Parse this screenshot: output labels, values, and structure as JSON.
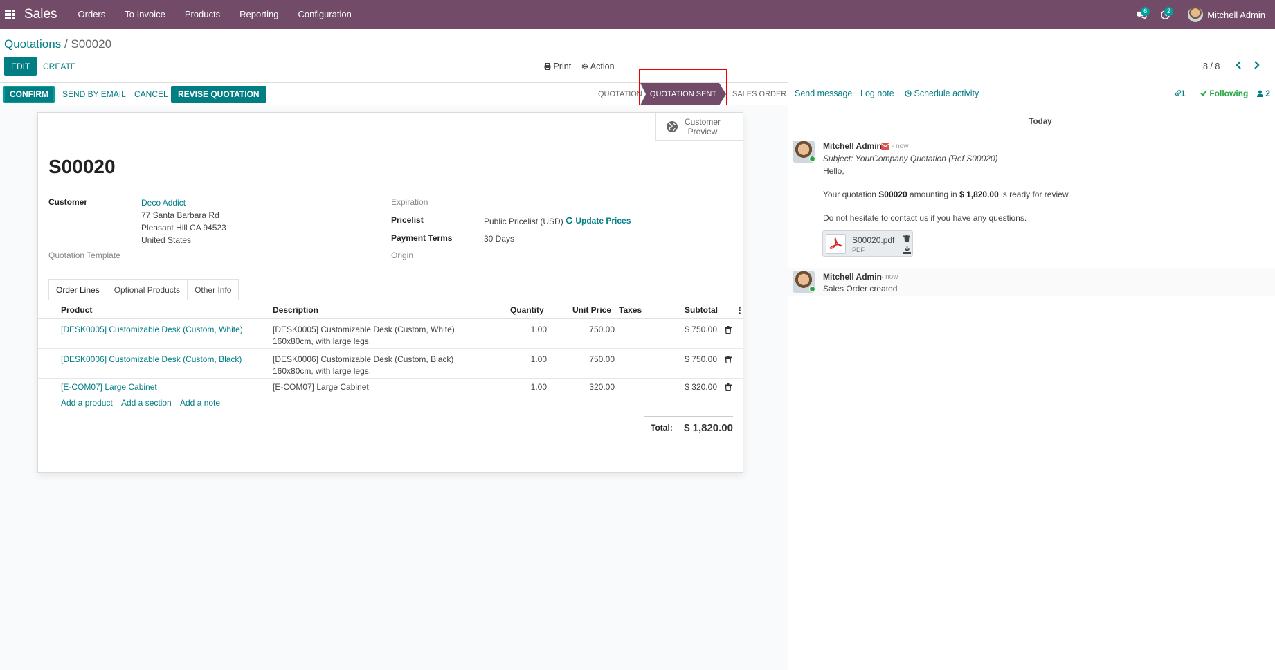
{
  "navbar": {
    "app_name": "Sales",
    "menu": [
      "Orders",
      "To Invoice",
      "Products",
      "Reporting",
      "Configuration"
    ],
    "messages_badge": "6",
    "activities_badge": "2",
    "user_name": "Mitchell Admin"
  },
  "control": {
    "breadcrumb_parent": "Quotations",
    "breadcrumb_sep": " / ",
    "breadcrumb_current": "S00020",
    "edit_label": "EDIT",
    "create_label": "CREATE",
    "print_label": "Print",
    "action_label": "Action",
    "pager": "8 / 8"
  },
  "statusbar": {
    "confirm": "CONFIRM",
    "send_by_email": "SEND BY EMAIL",
    "cancel": "CANCEL",
    "revise": "REVISE QUOTATION",
    "stages": [
      "QUOTATION",
      "QUOTATION SENT",
      "SALES ORDER"
    ],
    "active_stage": "QUOTATION SENT"
  },
  "form": {
    "preview_line1": "Customer",
    "preview_line2": "Preview",
    "title": "S00020",
    "customer_label": "Customer",
    "customer_name": "Deco Addict",
    "address_line1": "77 Santa Barbara Rd",
    "address_line2": "Pleasant Hill CA 94523",
    "address_line3": "United States",
    "template_label": "Quotation Template",
    "expiration_label": "Expiration",
    "pricelist_label": "Pricelist",
    "pricelist_value": "Public Pricelist (USD)",
    "update_prices": "Update Prices",
    "payment_terms_label": "Payment Terms",
    "payment_terms_value": "30 Days",
    "origin_label": "Origin"
  },
  "tabs": [
    "Order Lines",
    "Optional Products",
    "Other Info"
  ],
  "lines": {
    "headers": {
      "product": "Product",
      "description": "Description",
      "quantity": "Quantity",
      "unit_price": "Unit Price",
      "taxes": "Taxes",
      "subtotal": "Subtotal"
    },
    "rows": [
      {
        "product": "[DESK0005] Customizable Desk (Custom, White)",
        "desc1": "[DESK0005] Customizable Desk (Custom, White)",
        "desc2": "160x80cm, with large legs.",
        "quantity": "1.00",
        "unit_price": "750.00",
        "subtotal": "$ 750.00"
      },
      {
        "product": "[DESK0006] Customizable Desk (Custom, Black)",
        "desc1": "[DESK0006] Customizable Desk (Custom, Black)",
        "desc2": "160x80cm, with large legs.",
        "quantity": "1.00",
        "unit_price": "750.00",
        "subtotal": "$ 750.00"
      },
      {
        "product": "[E-COM07] Large Cabinet",
        "desc1": "[E-COM07] Large Cabinet",
        "desc2": "",
        "quantity": "1.00",
        "unit_price": "320.00",
        "subtotal": "$ 320.00"
      }
    ],
    "add_product": "Add a product",
    "add_section": "Add a section",
    "add_note": "Add a note",
    "total_label": "Total:",
    "total_value": "$ 1,820.00"
  },
  "chatter": {
    "send_message": "Send message",
    "log_note": "Log note",
    "schedule_activity": "Schedule activity",
    "attachments_count": "1",
    "following": "Following",
    "followers_count": "2",
    "today": "Today",
    "messages": [
      {
        "author": "Mitchell Admin",
        "time": "- now",
        "subject": "Subject: YourCompany Quotation (Ref S00020)",
        "hello": "Hello,",
        "body_prefix": "Your quotation ",
        "body_ref": "S00020",
        "body_mid": " amounting in ",
        "body_amount": "$ 1,820.00",
        "body_suffix": " is ready for review.",
        "closing": "Do not hesitate to contact us if you have any questions.",
        "attachment_name": "S00020.pdf",
        "attachment_ext": "PDF"
      },
      {
        "author": "Mitchell Admin",
        "time": "- now",
        "body": "Sales Order created"
      }
    ]
  }
}
